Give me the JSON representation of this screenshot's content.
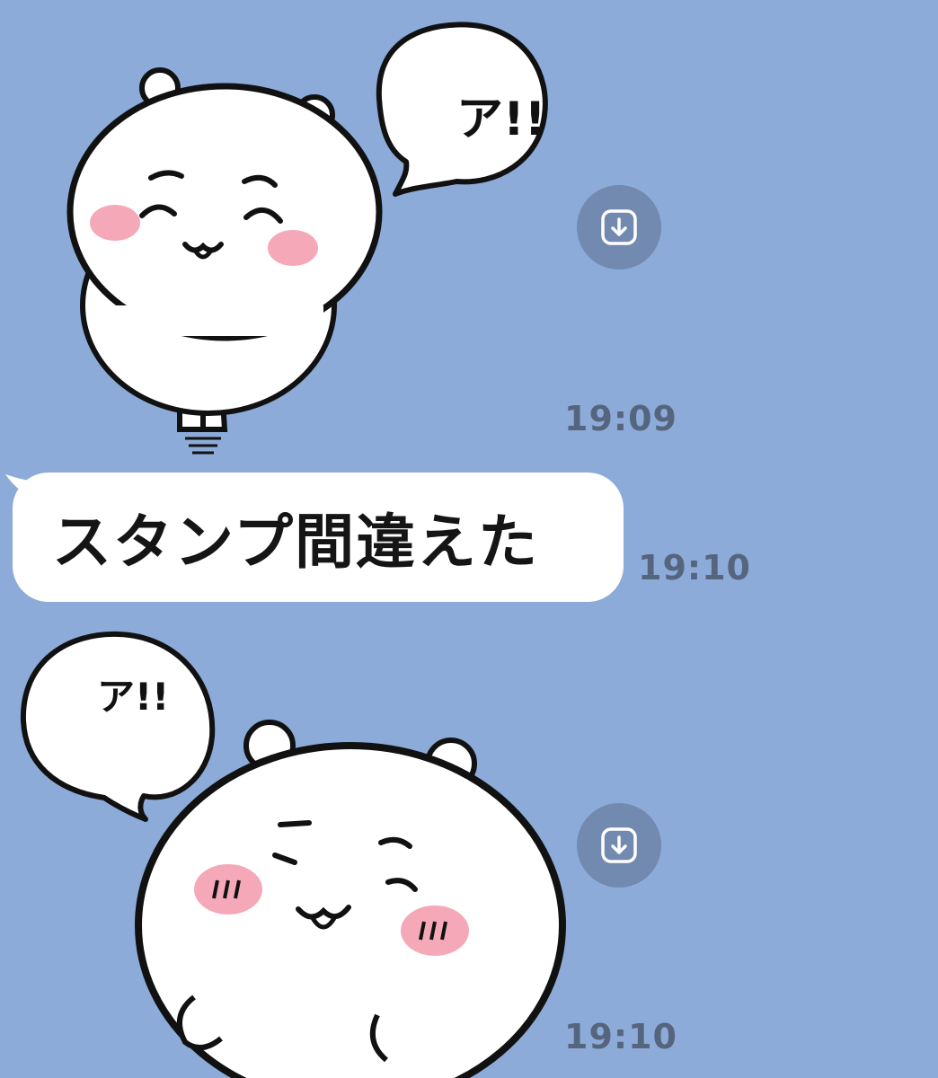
{
  "colors": {
    "chat_background": "#8CABD8",
    "bubble": "#FFFFFF",
    "timestamp": "#56657E",
    "download_button": "#7289B0",
    "blush": "#F4A8B8"
  },
  "messages": [
    {
      "kind": "sticker",
      "sticker_text": "ア!!",
      "time": "19:09",
      "action_icon": "download-icon"
    },
    {
      "kind": "text",
      "text": "スタンプ間違えた",
      "time": "19:10"
    },
    {
      "kind": "sticker",
      "sticker_text": "ア!!",
      "time": "19:10",
      "action_icon": "download-icon"
    }
  ]
}
